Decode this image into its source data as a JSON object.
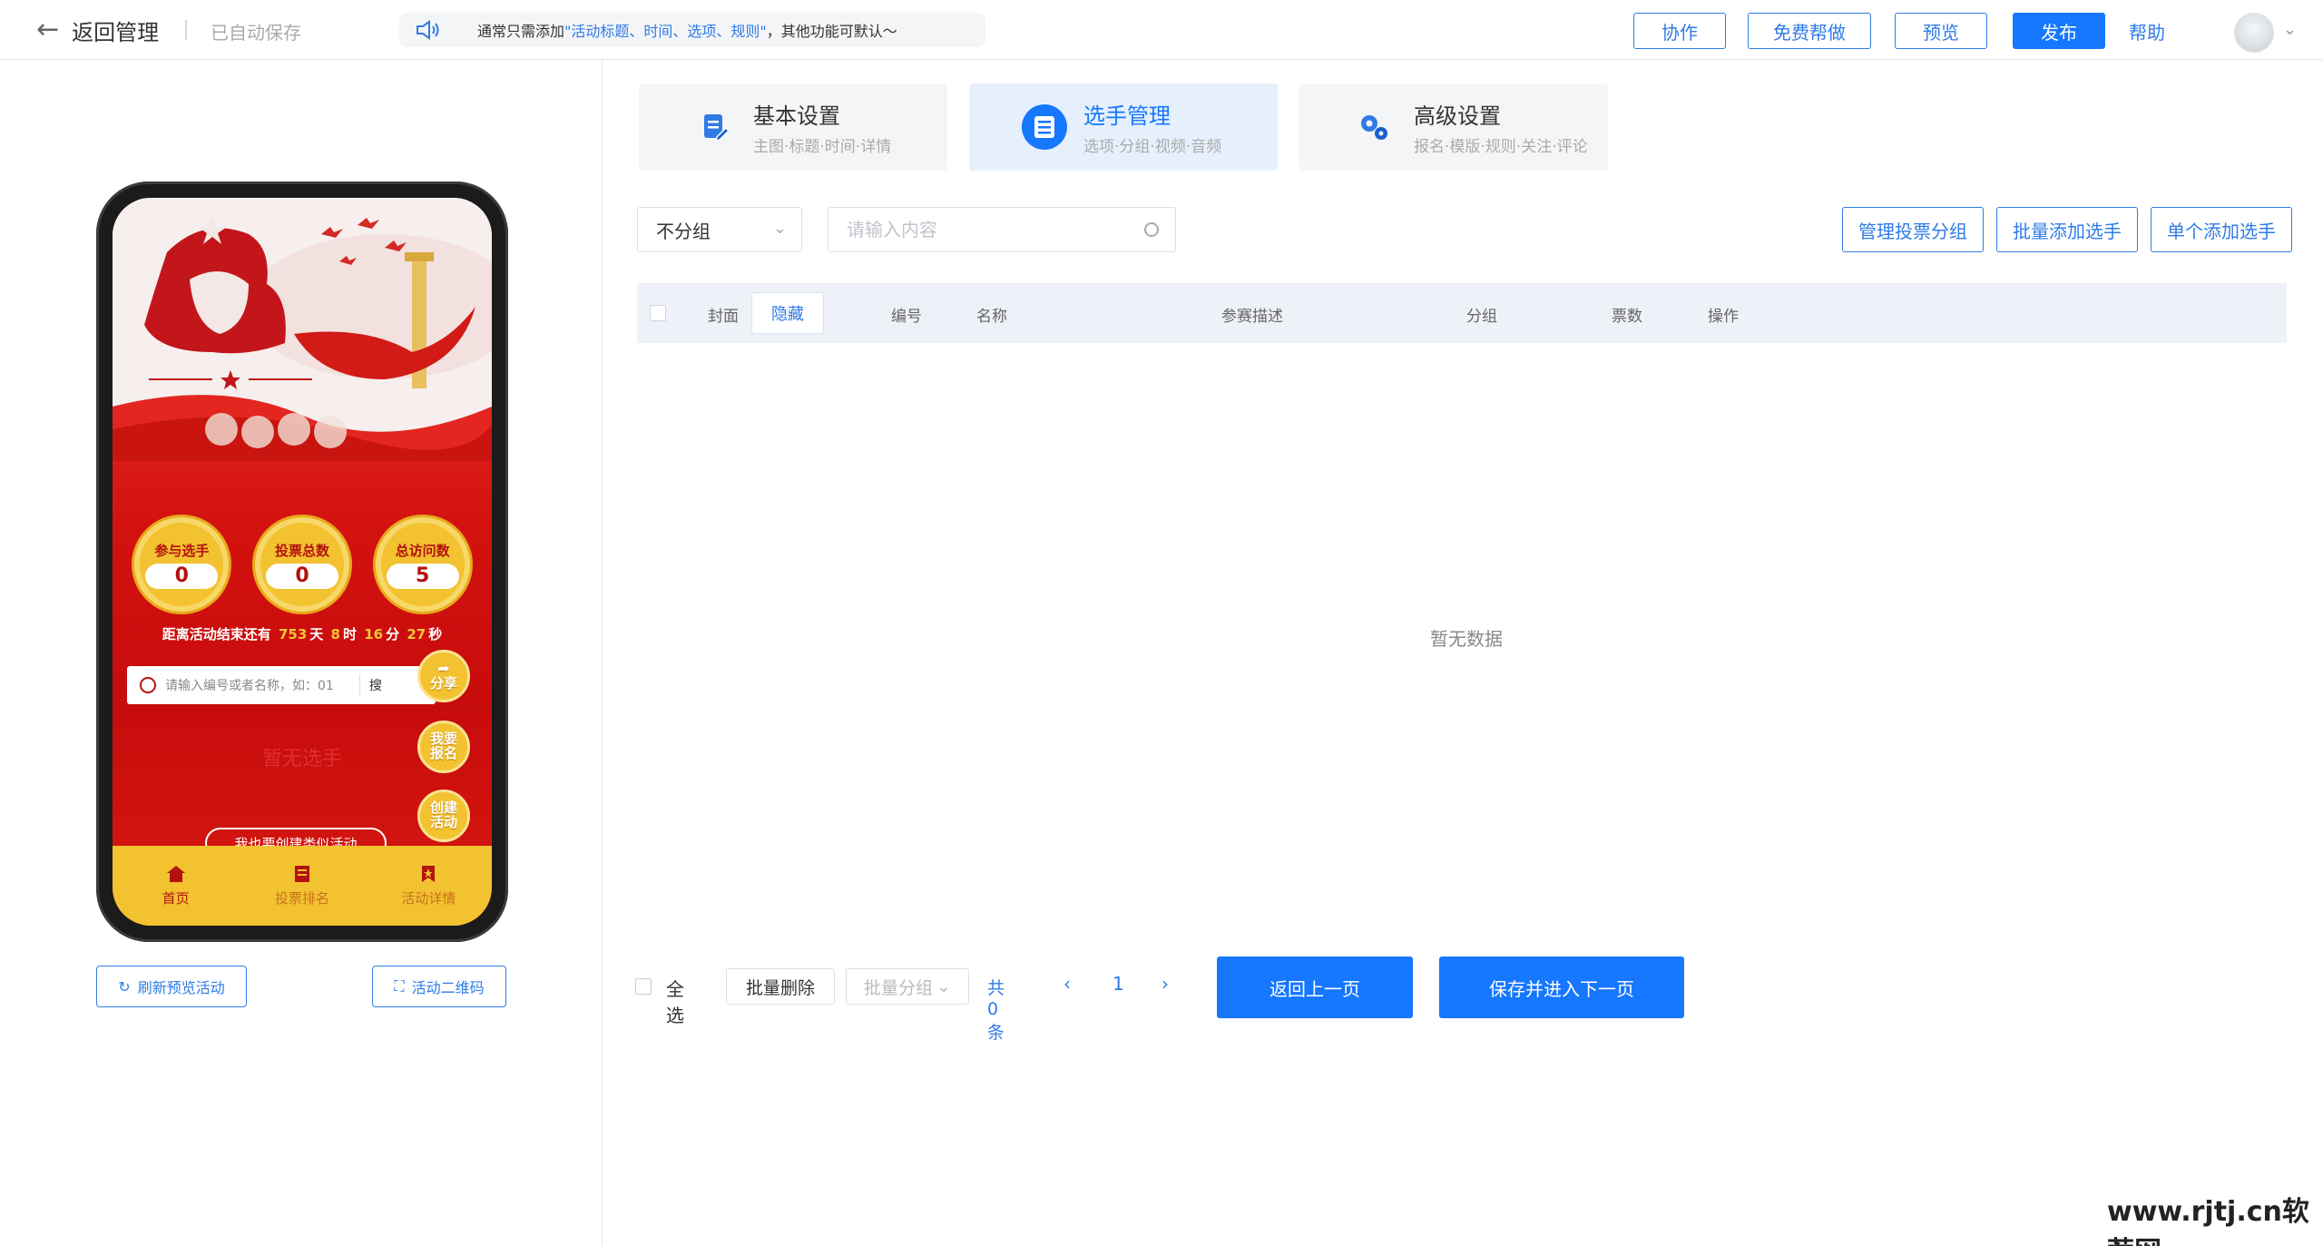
{
  "header": {
    "back_label": "返回管理",
    "autosave": "已自动保存",
    "notice": {
      "prefix": "通常只需添加",
      "highlight": "\"活动标题、时间、选项、规则\"",
      "suffix": "，其他功能可默认～"
    },
    "buttons": {
      "collab": "协作",
      "free_help": "免费帮做",
      "preview": "预览",
      "publish": "发布"
    },
    "help": "帮助"
  },
  "preview": {
    "stats": [
      {
        "label": "参与选手",
        "value": "0"
      },
      {
        "label": "投票总数",
        "value": "0"
      },
      {
        "label": "总访问数",
        "value": "5"
      }
    ],
    "countdown": {
      "prefix": "距离活动结束还有",
      "days": "753",
      "days_unit": "天",
      "hours": "8",
      "hours_unit": "时",
      "minutes": "16",
      "minutes_unit": "分",
      "seconds": "27",
      "seconds_unit": "秒"
    },
    "search_placeholder": "请输入编号或者名称，如：01",
    "search_btn": "搜",
    "share": "分享",
    "signup": "我要报名",
    "create_activity": "创建活动",
    "no_player": "暂无选手",
    "create_similar": "我也要创建类似活动",
    "nav": [
      {
        "label": "首页"
      },
      {
        "label": "投票排名"
      },
      {
        "label": "活动详情"
      }
    ]
  },
  "left_actions": {
    "refresh": "刷新预览活动",
    "qrcode": "活动二维码"
  },
  "tabs": [
    {
      "title": "基本设置",
      "sub": "主图·标题·时间·详情"
    },
    {
      "title": "选手管理",
      "sub": "选项·分组·视频·音频"
    },
    {
      "title": "高级设置",
      "sub": "报名·模版·规则·关注·评论"
    }
  ],
  "toolbar": {
    "group_select": "不分组",
    "search_placeholder": "请输入内容",
    "manage_groups": "管理投票分组",
    "batch_add": "批量添加选手",
    "single_add": "单个添加选手"
  },
  "table": {
    "columns": {
      "cover": "封面",
      "hide": "隐藏",
      "number": "编号",
      "name": "名称",
      "desc": "参赛描述",
      "group": "分组",
      "votes": "票数",
      "ops": "操作"
    },
    "empty": "暂无数据"
  },
  "footer": {
    "select_all": "全选",
    "batch_delete": "批量删除",
    "batch_group": "批量分组",
    "total": "共 0 条",
    "page": "1",
    "prev_page": "返回上一页",
    "save_next": "保存并进入下一页"
  },
  "watermark": "www.rjtj.cn软荐网",
  "colors": {
    "primary": "#1677ff",
    "link": "#2f7be6",
    "preview_red": "#d3120f",
    "preview_gold": "#f2c230"
  },
  "icons": [
    "back-arrow-icon",
    "speaker-icon",
    "chevron-down-icon",
    "search-icon",
    "refresh-icon",
    "qrcode-icon",
    "edit-doc-icon",
    "list-icon",
    "gears-icon",
    "home-icon",
    "ranking-icon",
    "detail-icon",
    "share-icon"
  ]
}
